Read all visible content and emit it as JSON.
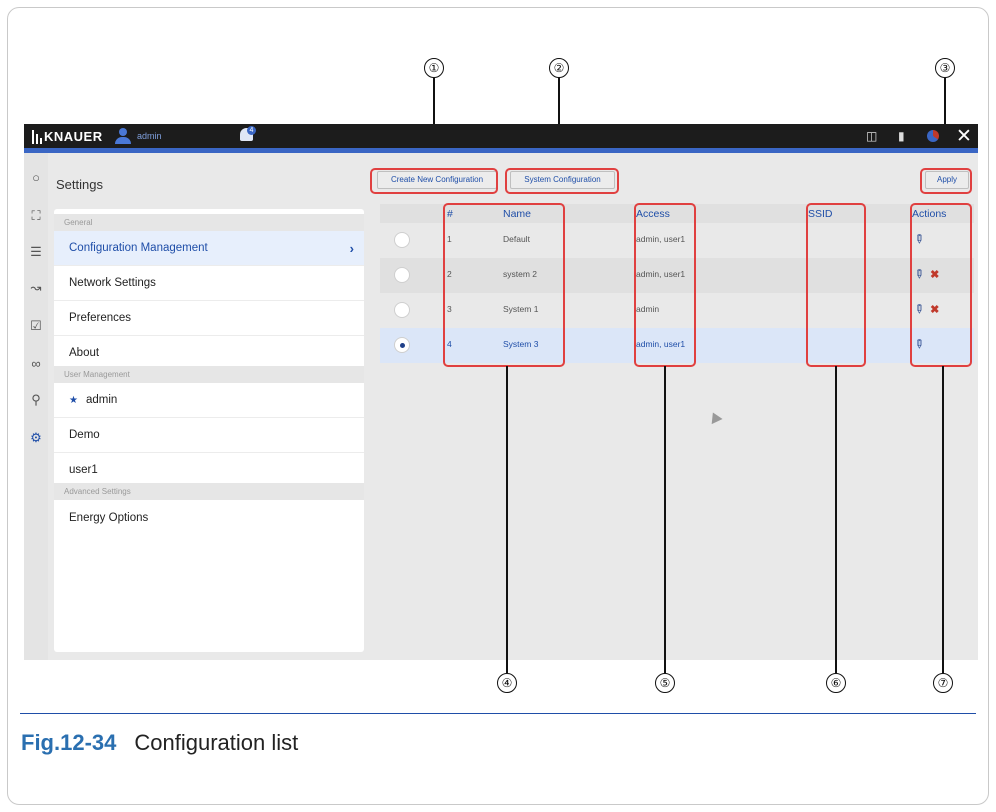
{
  "callouts": [
    "①",
    "②",
    "③",
    "④",
    "⑤",
    "⑥",
    "⑦"
  ],
  "app": {
    "logo": "KNAUER",
    "username": "admin",
    "notification_count": "4"
  },
  "settings": {
    "title": "Settings",
    "sections": {
      "general": "General",
      "user_management": "User Management",
      "advanced": "Advanced Settings"
    },
    "items": {
      "config_mgmt": "Configuration Management",
      "network": "Network Settings",
      "preferences": "Preferences",
      "about": "About",
      "user_admin": "admin",
      "user_demo": "Demo",
      "user_user1": "user1",
      "energy": "Energy Options"
    }
  },
  "toolbar": {
    "create_new": "Create New Configuration",
    "system_config": "System Configuration",
    "apply": "Apply"
  },
  "table": {
    "headers": {
      "num": "#",
      "name": "Name",
      "access": "Access",
      "ssid": "SSID",
      "actions": "Actions"
    },
    "rows": [
      {
        "num": "1",
        "name": "Default",
        "access": "admin, user1",
        "ssid": ""
      },
      {
        "num": "2",
        "name": "system 2",
        "access": "admin, user1",
        "ssid": ""
      },
      {
        "num": "3",
        "name": "System 1",
        "access": "admin",
        "ssid": ""
      },
      {
        "num": "4",
        "name": "System 3",
        "access": "admin, user1",
        "ssid": ""
      }
    ]
  },
  "caption": {
    "label": "Fig.12-34",
    "text": "Configuration list"
  },
  "colors": {
    "accent": "#1f4ea8",
    "highlight": "#e04040",
    "caption_blue": "#2a6fb0"
  }
}
